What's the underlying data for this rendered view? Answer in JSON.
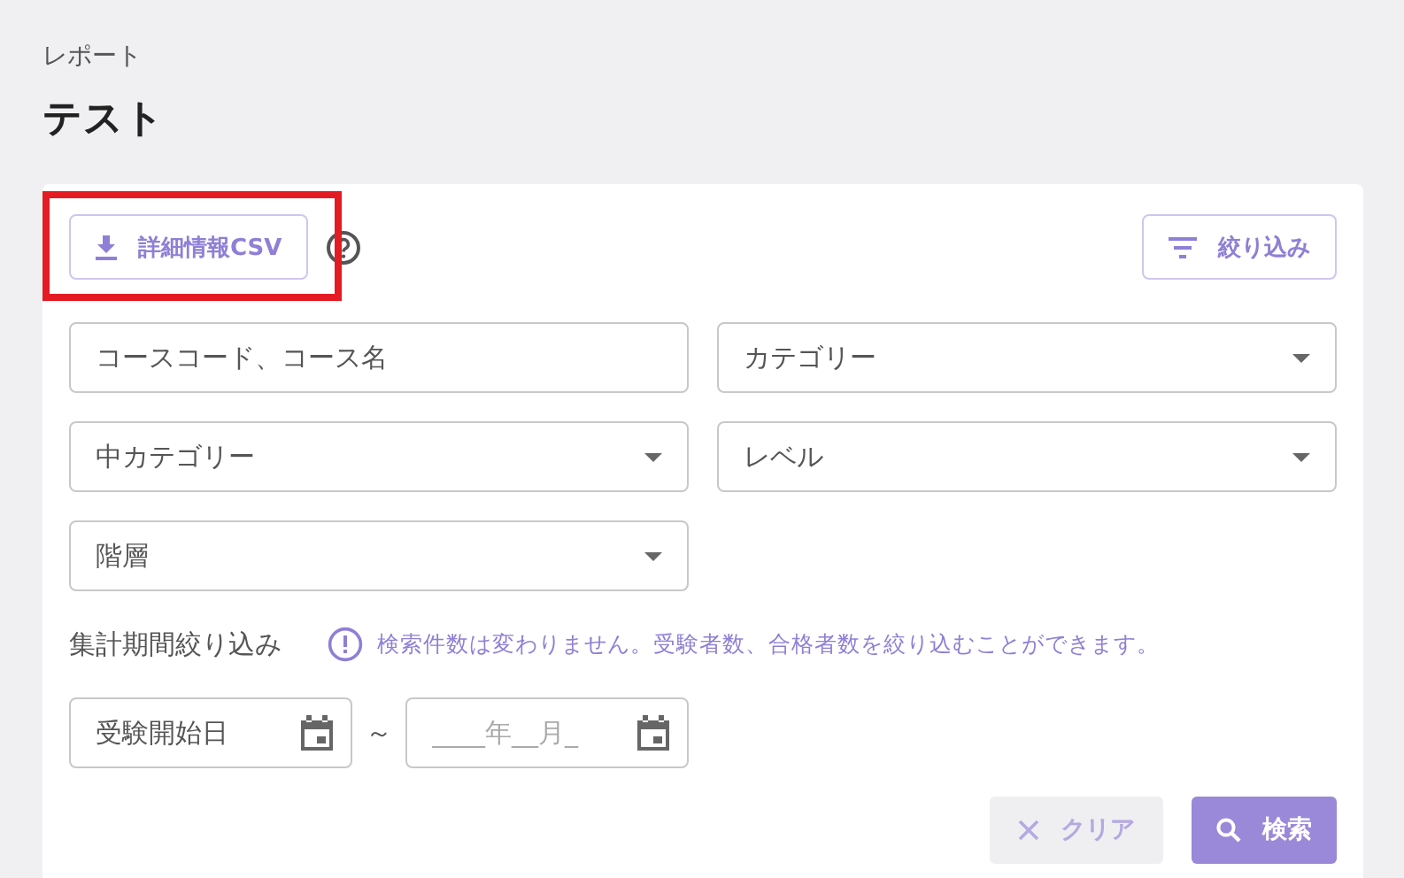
{
  "breadcrumb": "レポート",
  "title": "テスト",
  "toolbar": {
    "csv_button": {
      "label": "詳細情報CSV",
      "highlighted": true
    },
    "filter_button": {
      "label": "絞り込み"
    }
  },
  "fields": [
    {
      "kind": "text",
      "placeholder": "コースコード、コース名"
    },
    {
      "kind": "select",
      "placeholder": "カテゴリー"
    },
    {
      "kind": "select",
      "placeholder": "中カテゴリー"
    },
    {
      "kind": "select",
      "placeholder": "レベル"
    },
    {
      "kind": "select",
      "placeholder": "階層"
    }
  ],
  "period": {
    "label": "集計期間絞り込み",
    "note": "検索件数は変わりません。受験者数、合格者数を絞り込むことができます。"
  },
  "date_range": {
    "from": {
      "placeholder": "受験開始日"
    },
    "separator": "～",
    "to": {
      "placeholder": "____年__月_"
    }
  },
  "buttons": [
    {
      "kind": "clear",
      "label": "クリア",
      "disabled": true
    },
    {
      "kind": "search",
      "label": "検索",
      "disabled": false
    }
  ]
}
